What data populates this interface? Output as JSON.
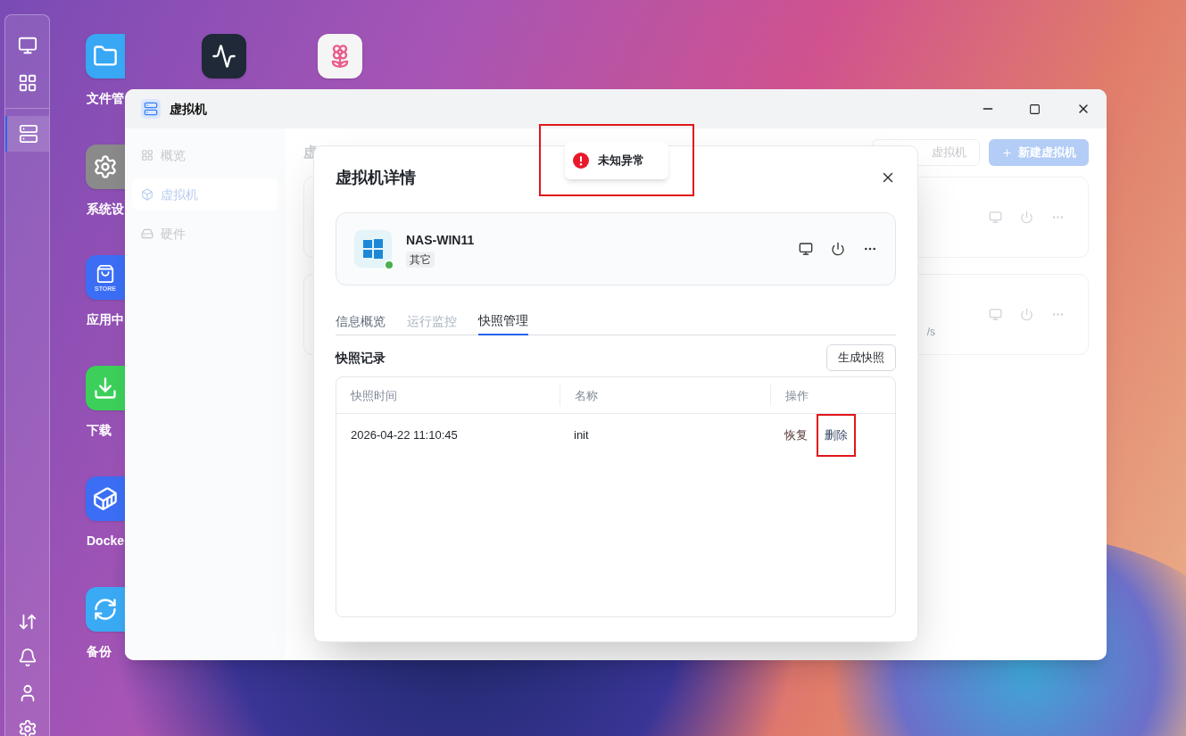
{
  "dock": {
    "top": [
      {
        "kind": "monitor",
        "selected": false
      },
      {
        "kind": "apps",
        "selected": false
      }
    ],
    "pinned": [
      {
        "kind": "vm",
        "selected": true
      }
    ],
    "bottom": [
      {
        "kind": "transfer"
      },
      {
        "kind": "bell"
      },
      {
        "kind": "user"
      },
      {
        "kind": "gear"
      }
    ]
  },
  "desktop_icons": [
    {
      "kind": "files",
      "label": "文件管"
    },
    {
      "kind": "settings",
      "label": "系统设"
    },
    {
      "kind": "store",
      "label": "应用中",
      "badge": "STORE"
    },
    {
      "kind": "download",
      "label": "下载"
    },
    {
      "kind": "docker",
      "label": "Docke"
    },
    {
      "kind": "backup",
      "label": "备份"
    }
  ],
  "desktop_top_icons": [
    {
      "kind": "activity"
    },
    {
      "kind": "photos"
    }
  ],
  "window": {
    "title": "虚拟机",
    "nav": [
      {
        "kind": "overview",
        "label": "概览",
        "selected": false
      },
      {
        "kind": "vm",
        "label": "虚拟机",
        "selected": true
      },
      {
        "kind": "hardware",
        "label": "硬件",
        "selected": false
      }
    ],
    "heading": "虚",
    "buttons": [
      {
        "kind": "outline",
        "label": "虚拟机"
      },
      {
        "kind": "primary",
        "label": "新建虚拟机"
      }
    ],
    "vm_rows": [
      {
        "detail": ""
      },
      {
        "detail": "/s"
      }
    ]
  },
  "dialog": {
    "title": "虚拟机详情",
    "vm": {
      "name": "NAS-WIN11",
      "tag": "其它",
      "running": true
    },
    "tabs": [
      {
        "label": "信息概览",
        "selected": false,
        "disabled": false
      },
      {
        "label": "运行监控",
        "selected": false,
        "disabled": true
      },
      {
        "label": "快照管理",
        "selected": true,
        "disabled": false
      }
    ],
    "section_title": "快照记录",
    "create_button": "生成快照",
    "columns": [
      "快照时间",
      "名称",
      "操作"
    ],
    "rows": [
      {
        "time": "2026-04-22 11:10:45",
        "name": "init",
        "actions": [
          {
            "kind": "restore",
            "label": "恢复",
            "highlighted": false
          },
          {
            "kind": "delete",
            "label": "删除",
            "highlighted": true
          }
        ]
      }
    ]
  },
  "toast": {
    "kind": "error",
    "message": "未知异常",
    "highlighted": true
  }
}
